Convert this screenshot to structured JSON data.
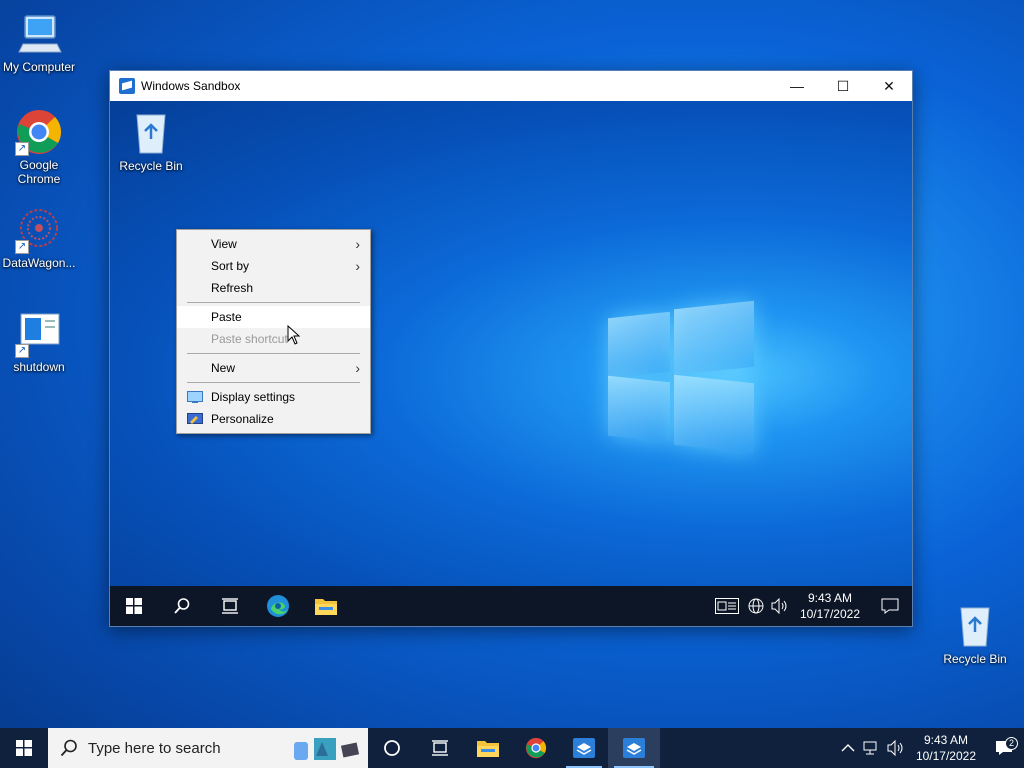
{
  "desktop": {
    "icons": [
      {
        "label": "My Computer"
      },
      {
        "label": "Google Chrome"
      },
      {
        "label": "DataWagon..."
      },
      {
        "label": "shutdown"
      },
      {
        "label": "Recycle Bin"
      }
    ]
  },
  "sandbox": {
    "title": "Windows Sandbox",
    "controls": {
      "minimize": "—",
      "maximize": "☐",
      "close": "✕"
    },
    "recycle_bin_label": "Recycle Bin",
    "context_menu": {
      "view": "View",
      "sort_by": "Sort by",
      "refresh": "Refresh",
      "paste": "Paste",
      "paste_shortcut": "Paste shortcut",
      "new": "New",
      "display_settings": "Display settings",
      "personalize": "Personalize"
    },
    "taskbar": {
      "time": "9:43 AM",
      "date": "10/17/2022"
    }
  },
  "taskbar": {
    "search_placeholder": "Type here to search",
    "time": "9:43 AM",
    "date": "10/17/2022",
    "notification_count": "2"
  },
  "colors": {
    "accent": "#0a63d6",
    "taskbar": "#10213d",
    "menu_bg": "#f2f2f2"
  }
}
